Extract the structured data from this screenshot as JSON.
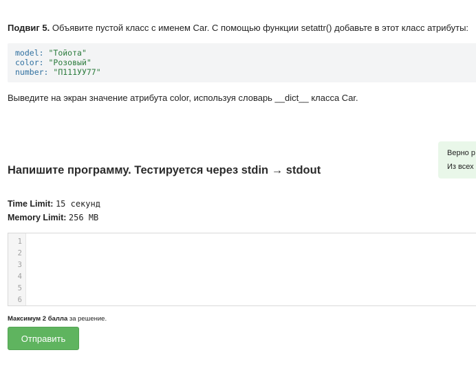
{
  "task": {
    "prefix": "Подвиг 5.",
    "text": " Объявите пустой класс с именем Car. С помощью функции setattr() добавьте в этот класс атрибуты:",
    "code_lines": [
      {
        "key": "model:",
        "value": "\"Тойота\""
      },
      {
        "key": "color:",
        "value": "\"Розовый\""
      },
      {
        "key": "number:",
        "value": "\"П111УУ77\""
      }
    ],
    "after_text": "Выведите на экран значение атрибута color, используя словарь __dict__ класса Car."
  },
  "hint": {
    "line1": "Верно р",
    "line2": "Из всех"
  },
  "section_title": "Напишите программу. Тестируется через stdin → stdout",
  "limits": {
    "time_label": "Time Limit:",
    "time_value": "15 секунд",
    "memory_label": "Memory Limit:",
    "memory_value": "256 MB"
  },
  "editor": {
    "line_numbers": [
      "1",
      "2",
      "3",
      "4",
      "5",
      "6"
    ],
    "content": ""
  },
  "score_note": {
    "bold": "Максимум 2 балла",
    "rest": " за решение."
  },
  "submit_label": "Отправить"
}
